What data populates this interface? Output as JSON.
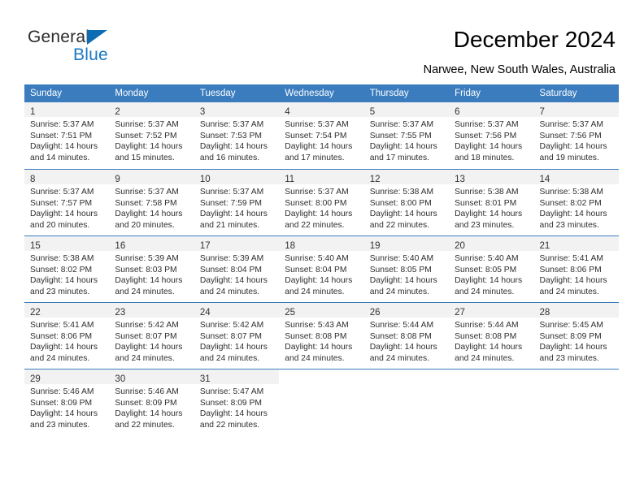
{
  "brand": {
    "name_part1": "General",
    "name_part2": "Blue",
    "triangle_color": "#0d6cb4",
    "blue_color": "#1878c4"
  },
  "header": {
    "title": "December 2024",
    "subtitle": "Narwee, New South Wales, Australia"
  },
  "theme": {
    "header_bg": "#3a7cbe",
    "daynum_bg": "#f2f2f2",
    "cell_bg": "#ffffff",
    "text": "#2e2e2e"
  },
  "calendar": {
    "columns": [
      "Sunday",
      "Monday",
      "Tuesday",
      "Wednesday",
      "Thursday",
      "Friday",
      "Saturday"
    ],
    "weeks": [
      [
        {
          "day": "1",
          "sunrise": "Sunrise: 5:37 AM",
          "sunset": "Sunset: 7:51 PM",
          "daylight_line1": "Daylight: 14 hours",
          "daylight_line2": "and 14 minutes."
        },
        {
          "day": "2",
          "sunrise": "Sunrise: 5:37 AM",
          "sunset": "Sunset: 7:52 PM",
          "daylight_line1": "Daylight: 14 hours",
          "daylight_line2": "and 15 minutes."
        },
        {
          "day": "3",
          "sunrise": "Sunrise: 5:37 AM",
          "sunset": "Sunset: 7:53 PM",
          "daylight_line1": "Daylight: 14 hours",
          "daylight_line2": "and 16 minutes."
        },
        {
          "day": "4",
          "sunrise": "Sunrise: 5:37 AM",
          "sunset": "Sunset: 7:54 PM",
          "daylight_line1": "Daylight: 14 hours",
          "daylight_line2": "and 17 minutes."
        },
        {
          "day": "5",
          "sunrise": "Sunrise: 5:37 AM",
          "sunset": "Sunset: 7:55 PM",
          "daylight_line1": "Daylight: 14 hours",
          "daylight_line2": "and 17 minutes."
        },
        {
          "day": "6",
          "sunrise": "Sunrise: 5:37 AM",
          "sunset": "Sunset: 7:56 PM",
          "daylight_line1": "Daylight: 14 hours",
          "daylight_line2": "and 18 minutes."
        },
        {
          "day": "7",
          "sunrise": "Sunrise: 5:37 AM",
          "sunset": "Sunset: 7:56 PM",
          "daylight_line1": "Daylight: 14 hours",
          "daylight_line2": "and 19 minutes."
        }
      ],
      [
        {
          "day": "8",
          "sunrise": "Sunrise: 5:37 AM",
          "sunset": "Sunset: 7:57 PM",
          "daylight_line1": "Daylight: 14 hours",
          "daylight_line2": "and 20 minutes."
        },
        {
          "day": "9",
          "sunrise": "Sunrise: 5:37 AM",
          "sunset": "Sunset: 7:58 PM",
          "daylight_line1": "Daylight: 14 hours",
          "daylight_line2": "and 20 minutes."
        },
        {
          "day": "10",
          "sunrise": "Sunrise: 5:37 AM",
          "sunset": "Sunset: 7:59 PM",
          "daylight_line1": "Daylight: 14 hours",
          "daylight_line2": "and 21 minutes."
        },
        {
          "day": "11",
          "sunrise": "Sunrise: 5:37 AM",
          "sunset": "Sunset: 8:00 PM",
          "daylight_line1": "Daylight: 14 hours",
          "daylight_line2": "and 22 minutes."
        },
        {
          "day": "12",
          "sunrise": "Sunrise: 5:38 AM",
          "sunset": "Sunset: 8:00 PM",
          "daylight_line1": "Daylight: 14 hours",
          "daylight_line2": "and 22 minutes."
        },
        {
          "day": "13",
          "sunrise": "Sunrise: 5:38 AM",
          "sunset": "Sunset: 8:01 PM",
          "daylight_line1": "Daylight: 14 hours",
          "daylight_line2": "and 23 minutes."
        },
        {
          "day": "14",
          "sunrise": "Sunrise: 5:38 AM",
          "sunset": "Sunset: 8:02 PM",
          "daylight_line1": "Daylight: 14 hours",
          "daylight_line2": "and 23 minutes."
        }
      ],
      [
        {
          "day": "15",
          "sunrise": "Sunrise: 5:38 AM",
          "sunset": "Sunset: 8:02 PM",
          "daylight_line1": "Daylight: 14 hours",
          "daylight_line2": "and 23 minutes."
        },
        {
          "day": "16",
          "sunrise": "Sunrise: 5:39 AM",
          "sunset": "Sunset: 8:03 PM",
          "daylight_line1": "Daylight: 14 hours",
          "daylight_line2": "and 24 minutes."
        },
        {
          "day": "17",
          "sunrise": "Sunrise: 5:39 AM",
          "sunset": "Sunset: 8:04 PM",
          "daylight_line1": "Daylight: 14 hours",
          "daylight_line2": "and 24 minutes."
        },
        {
          "day": "18",
          "sunrise": "Sunrise: 5:40 AM",
          "sunset": "Sunset: 8:04 PM",
          "daylight_line1": "Daylight: 14 hours",
          "daylight_line2": "and 24 minutes."
        },
        {
          "day": "19",
          "sunrise": "Sunrise: 5:40 AM",
          "sunset": "Sunset: 8:05 PM",
          "daylight_line1": "Daylight: 14 hours",
          "daylight_line2": "and 24 minutes."
        },
        {
          "day": "20",
          "sunrise": "Sunrise: 5:40 AM",
          "sunset": "Sunset: 8:05 PM",
          "daylight_line1": "Daylight: 14 hours",
          "daylight_line2": "and 24 minutes."
        },
        {
          "day": "21",
          "sunrise": "Sunrise: 5:41 AM",
          "sunset": "Sunset: 8:06 PM",
          "daylight_line1": "Daylight: 14 hours",
          "daylight_line2": "and 24 minutes."
        }
      ],
      [
        {
          "day": "22",
          "sunrise": "Sunrise: 5:41 AM",
          "sunset": "Sunset: 8:06 PM",
          "daylight_line1": "Daylight: 14 hours",
          "daylight_line2": "and 24 minutes."
        },
        {
          "day": "23",
          "sunrise": "Sunrise: 5:42 AM",
          "sunset": "Sunset: 8:07 PM",
          "daylight_line1": "Daylight: 14 hours",
          "daylight_line2": "and 24 minutes."
        },
        {
          "day": "24",
          "sunrise": "Sunrise: 5:42 AM",
          "sunset": "Sunset: 8:07 PM",
          "daylight_line1": "Daylight: 14 hours",
          "daylight_line2": "and 24 minutes."
        },
        {
          "day": "25",
          "sunrise": "Sunrise: 5:43 AM",
          "sunset": "Sunset: 8:08 PM",
          "daylight_line1": "Daylight: 14 hours",
          "daylight_line2": "and 24 minutes."
        },
        {
          "day": "26",
          "sunrise": "Sunrise: 5:44 AM",
          "sunset": "Sunset: 8:08 PM",
          "daylight_line1": "Daylight: 14 hours",
          "daylight_line2": "and 24 minutes."
        },
        {
          "day": "27",
          "sunrise": "Sunrise: 5:44 AM",
          "sunset": "Sunset: 8:08 PM",
          "daylight_line1": "Daylight: 14 hours",
          "daylight_line2": "and 24 minutes."
        },
        {
          "day": "28",
          "sunrise": "Sunrise: 5:45 AM",
          "sunset": "Sunset: 8:09 PM",
          "daylight_line1": "Daylight: 14 hours",
          "daylight_line2": "and 23 minutes."
        }
      ],
      [
        {
          "day": "29",
          "sunrise": "Sunrise: 5:46 AM",
          "sunset": "Sunset: 8:09 PM",
          "daylight_line1": "Daylight: 14 hours",
          "daylight_line2": "and 23 minutes."
        },
        {
          "day": "30",
          "sunrise": "Sunrise: 5:46 AM",
          "sunset": "Sunset: 8:09 PM",
          "daylight_line1": "Daylight: 14 hours",
          "daylight_line2": "and 22 minutes."
        },
        {
          "day": "31",
          "sunrise": "Sunrise: 5:47 AM",
          "sunset": "Sunset: 8:09 PM",
          "daylight_line1": "Daylight: 14 hours",
          "daylight_line2": "and 22 minutes."
        },
        {
          "day": "",
          "sunrise": "",
          "sunset": "",
          "daylight_line1": "",
          "daylight_line2": ""
        },
        {
          "day": "",
          "sunrise": "",
          "sunset": "",
          "daylight_line1": "",
          "daylight_line2": ""
        },
        {
          "day": "",
          "sunrise": "",
          "sunset": "",
          "daylight_line1": "",
          "daylight_line2": ""
        },
        {
          "day": "",
          "sunrise": "",
          "sunset": "",
          "daylight_line1": "",
          "daylight_line2": ""
        }
      ]
    ]
  }
}
